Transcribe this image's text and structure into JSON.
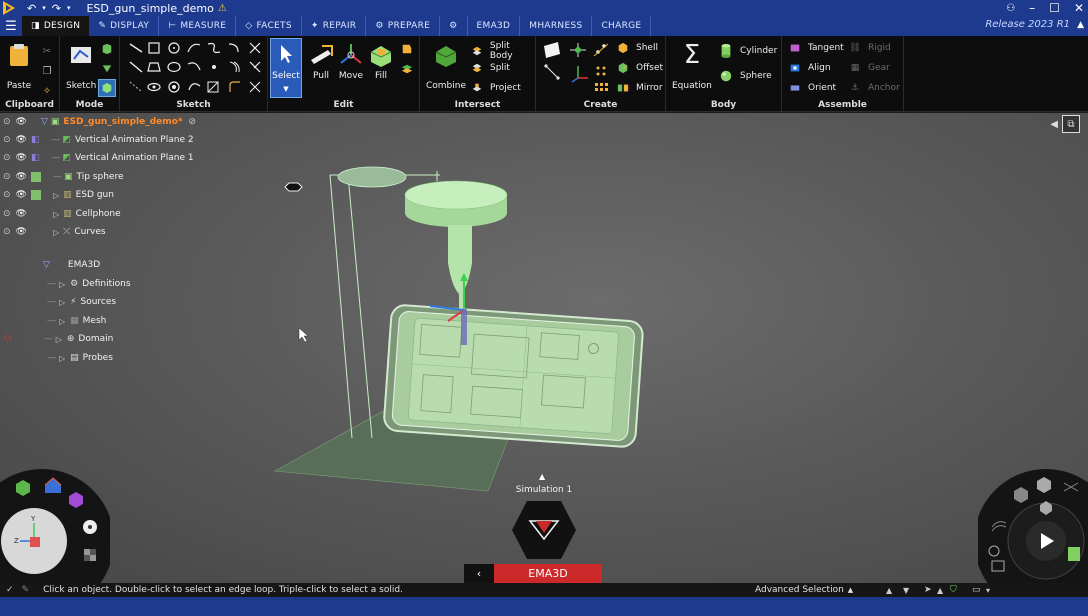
{
  "app": {
    "title": "ESD_gun_simple_demo",
    "release": "Release 2023 R1"
  },
  "tabs": [
    {
      "label": "DESIGN",
      "icon": "design-icon",
      "active": true
    },
    {
      "label": "DISPLAY",
      "icon": "display-icon"
    },
    {
      "label": "MEASURE",
      "icon": "measure-icon"
    },
    {
      "label": "FACETS",
      "icon": "facets-icon"
    },
    {
      "label": "REPAIR",
      "icon": "repair-icon"
    },
    {
      "label": "PREPARE",
      "icon": "prepare-icon"
    },
    {
      "label": "",
      "icon": "gear-extension-icon"
    },
    {
      "label": "EMA3D",
      "icon": ""
    },
    {
      "label": "MHARNESS",
      "icon": ""
    },
    {
      "label": "CHARGE",
      "icon": ""
    }
  ],
  "ribbon": {
    "clipboard": {
      "label": "Clipboard",
      "paste": "Paste"
    },
    "mode": {
      "label": "Mode",
      "sketch": "Sketch"
    },
    "sketch": {
      "label": "Sketch"
    },
    "edit": {
      "label": "Edit",
      "select": "Select",
      "pull": "Pull",
      "move": "Move",
      "fill": "Fill"
    },
    "intersect": {
      "label": "Intersect",
      "combine": "Combine",
      "split_body": "Split Body",
      "split": "Split",
      "project": "Project"
    },
    "create": {
      "label": "Create",
      "shell": "Shell",
      "offset": "Offset",
      "mirror": "Mirror"
    },
    "body": {
      "label": "Body",
      "equation": "Equation",
      "cylinder": "Cylinder",
      "sphere": "Sphere"
    },
    "assemble": {
      "label": "Assemble",
      "tangent": "Tangent",
      "align": "Align",
      "orient": "Orient",
      "rigid": "Rigid",
      "gear": "Gear",
      "anchor": "Anchor"
    }
  },
  "tree": {
    "root": "ESD_gun_simple_demo*",
    "items": [
      {
        "label": "Vertical Animation Plane 2",
        "icon": "plane-icon"
      },
      {
        "label": "Vertical Animation Plane 1",
        "icon": "plane-icon"
      },
      {
        "label": "Tip sphere",
        "icon": "body-icon"
      },
      {
        "label": "ESD gun",
        "icon": "component-icon"
      },
      {
        "label": "Cellphone",
        "icon": "component-icon"
      },
      {
        "label": "Curves",
        "icon": "curves-icon"
      }
    ],
    "ema3d": {
      "label": "EMA3D",
      "items": [
        {
          "label": "Definitions",
          "icon": "definitions-icon"
        },
        {
          "label": "Sources",
          "icon": "sources-icon"
        },
        {
          "label": "Mesh",
          "icon": "mesh-icon"
        },
        {
          "label": "Domain",
          "icon": "domain-icon"
        },
        {
          "label": "Probes",
          "icon": "probes-icon"
        }
      ]
    }
  },
  "viewport": {
    "simulation_label": "Simulation 1",
    "ema3d_button": "EMA3D"
  },
  "status": {
    "hint": "Click an object. Double-click to select an edge loop. Triple-click to select a solid.",
    "selection_mode": "Advanced Selection"
  },
  "colors": {
    "titlebar": "#1d3a8f",
    "ribbon": "#0d0d0d",
    "tree_root": "#ff8a2a",
    "model_green": "#b8e6b0",
    "ema3d_red": "#cc2a2a"
  }
}
